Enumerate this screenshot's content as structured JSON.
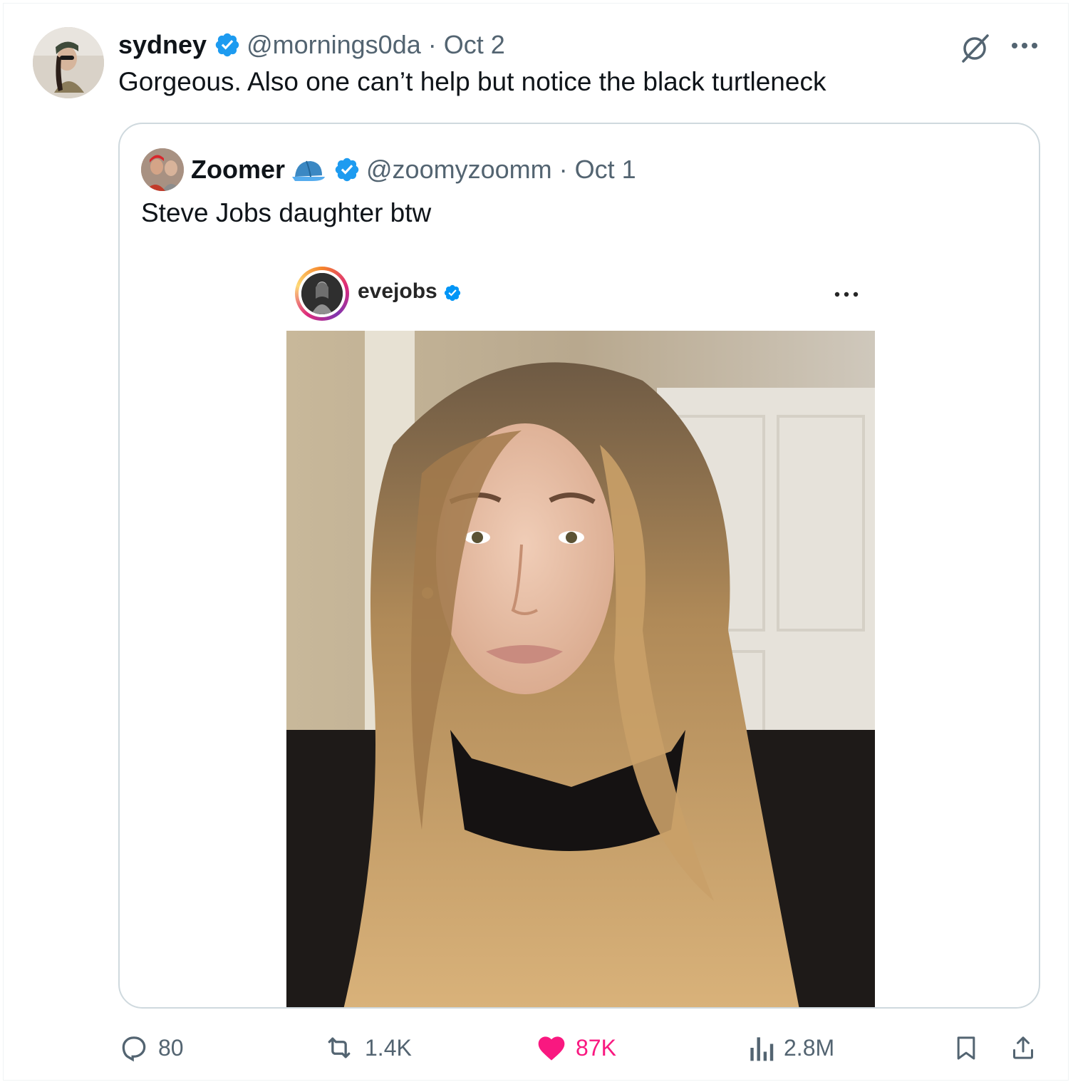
{
  "tweet": {
    "author_name": "sydney",
    "handle": "@mornings0da",
    "separator": "·",
    "date": "Oct 2",
    "text": "Gorgeous. Also one can’t help but notice the black turtleneck"
  },
  "quoted_tweet": {
    "author_name": "Zoomer",
    "handle": "@zoomyzoomm",
    "separator": "·",
    "date": "Oct 1",
    "text": "Steve Jobs daughter btw",
    "embedded_post": {
      "username": "evejobs"
    }
  },
  "actions": {
    "replies": "80",
    "reposts": "1.4K",
    "likes": "87K",
    "views": "2.8M"
  },
  "colors": {
    "verified": "#1d9bf0",
    "like": "#f91880",
    "secondary_text": "#536471"
  },
  "icons": [
    "verified-badge-icon",
    "grok-icon",
    "more-icon",
    "cap-emoji-icon",
    "reply-icon",
    "repost-icon",
    "like-icon",
    "views-icon",
    "bookmark-icon",
    "share-icon"
  ]
}
